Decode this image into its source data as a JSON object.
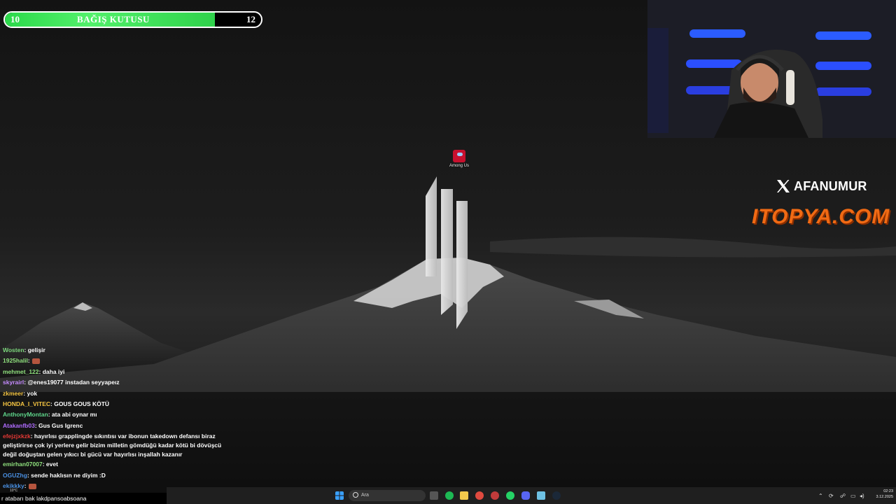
{
  "donation_bar": {
    "min": "10",
    "title": "BAĞIŞ KUTUSU",
    "max": "12",
    "progress": 0.82
  },
  "desktop": {
    "icon_label": "Among Us"
  },
  "branding": {
    "x_handle": "AFANUMUR",
    "sponsor": "ITOPYA.COM"
  },
  "chat": {
    "messages": [
      {
        "user": "Wosten",
        "text": ": gelişir",
        "color": "#7cd67c"
      },
      {
        "user": "1925halil",
        "text": ":",
        "color": "#8fe07d",
        "emote": true
      },
      {
        "user": "mehmet_122",
        "text": ": daha iyi",
        "color": "#8fe07d"
      },
      {
        "user": "skyrairl",
        "text": ": @enes19077 instadan seyyapeız",
        "color": "#c58bff"
      },
      {
        "user": "zkmeer",
        "text": ": yok",
        "color": "#f5c542"
      },
      {
        "user": "HONDA_I_VITEC",
        "text": ": GOUS GOUS KÖTÜ",
        "color": "#f5c542"
      },
      {
        "user": "AnthonyMontan",
        "text": ": ata abi oynar mı",
        "color": "#5fd68b"
      },
      {
        "user": "Atakanfb03",
        "text": ": Gus Gus Igrenc",
        "color": "#b06cff"
      },
      {
        "user": "efejzjxkzk",
        "text": ": hayırlısı grapplingde sıkıntısı var ibonun takedown defansı biraz geliştirirse çok iyi yerlere gelir bizim milletin gömdüğü kadar kötü bi dövüşcü değil doğuştan gelen yıkıcı bi gücü var hayırlısı inşallah kazanır",
        "color": "#e53935"
      },
      {
        "user": "emirhan07007",
        "text": ": evet",
        "color": "#8fe07d"
      },
      {
        "user": "OGUZhg",
        "text": ": sende haklısın ne diyim :D",
        "color": "#4a90e2"
      },
      {
        "user": "ekikkky",
        "text": ":",
        "color": "#4a90e2",
        "emote": true
      }
    ],
    "input_text": "r atabarı bak lakdpansoabsoana"
  },
  "taskbar": {
    "search_placeholder": "Ara",
    "weather": "10°C",
    "time": "02:23",
    "date": "3.12.2025"
  }
}
